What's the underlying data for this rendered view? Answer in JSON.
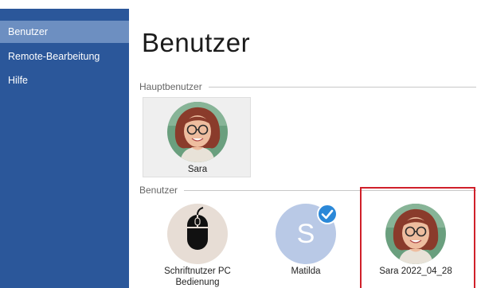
{
  "sidebar": {
    "items": [
      {
        "label": "Benutzer",
        "active": true
      },
      {
        "label": "Remote-Bearbeitung",
        "active": false
      },
      {
        "label": "Hilfe",
        "active": false
      }
    ]
  },
  "page": {
    "title": "Benutzer"
  },
  "sections": {
    "main_user": "Hauptbenutzer",
    "users": "Benutzer"
  },
  "main_user": {
    "name": "Sara"
  },
  "users": [
    {
      "name_line1": "Schriftnutzer PC",
      "name_line2": "Bedienung",
      "icon": "mouse-icon"
    },
    {
      "name": "Matilda",
      "initial": "S",
      "badge": "checkmark-icon"
    },
    {
      "name": "Sara 2022_04_28",
      "selected": true
    }
  ],
  "colors": {
    "sidebar": "#2b579a",
    "sidebar_active": "#6d8fc1",
    "badge": "#2b88d8",
    "selection": "#d0202a",
    "initial_avatar": "#b9c9e6"
  }
}
